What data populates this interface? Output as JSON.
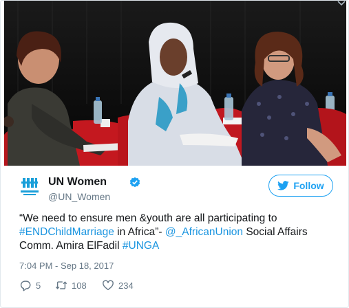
{
  "tweet": {
    "author_name": "UN Women",
    "handle": "@UN_Women",
    "follow_label": "Follow",
    "text_segments": [
      {
        "text": "“We need to ensure men &youth are all participating to",
        "link": false
      },
      {
        "text": "#ENDChildMarriage",
        "link": true
      },
      {
        "text": " in Africa”- ",
        "link": false
      },
      {
        "text": "@_AfricanUnion",
        "link": true
      },
      {
        "text": " Social Affairs",
        "link": false
      },
      {
        "text": "Comm. Amira ElFadil ",
        "link": false
      },
      {
        "text": "#UNGA",
        "link": true
      }
    ],
    "timestamp": "7:04 PM - Sep 18, 2017",
    "replies": "5",
    "retweets": "108",
    "likes": "234"
  },
  "avatar_icon": "un-women-logo",
  "verified_icon": "verified-badge-icon",
  "colors": {
    "accent": "#1da1f2",
    "link": "#1b95e0",
    "muted": "#657786",
    "text": "#14171a",
    "border": "#e1e8ed"
  }
}
